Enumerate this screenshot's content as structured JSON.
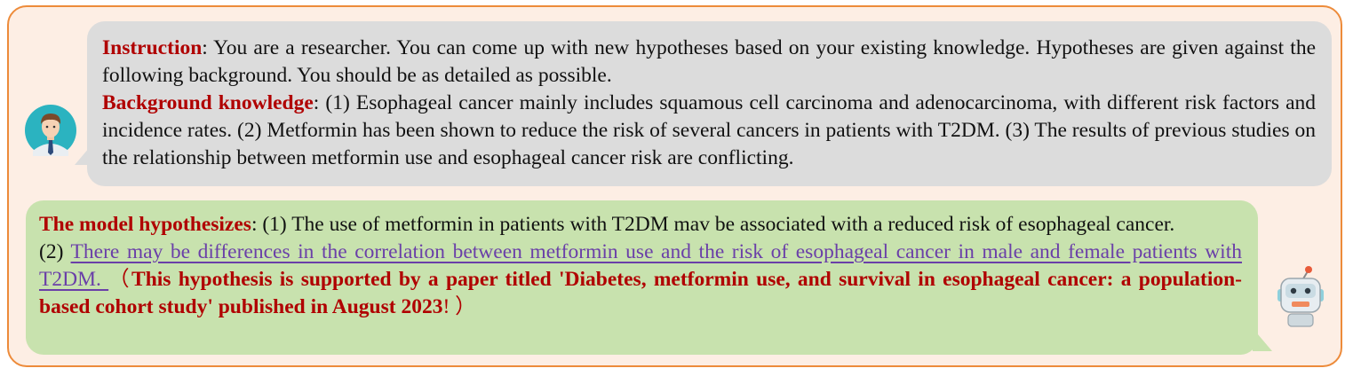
{
  "user": {
    "instruction_label": "Instruction",
    "instruction_text": ": You are a researcher. You can come up with new hypotheses based on your existing knowledge. Hypotheses are given against the following background. You should be as detailed as possible.",
    "background_label": "Background knowledge",
    "background_text": ": (1) Esophageal cancer mainly includes squamous cell carcinoma and adenocarcinoma, with different risk factors and incidence rates. (2) Metformin has been shown to reduce the risk of several cancers in patients with T2DM. (3) The results of previous studies on the relationship between metformin use and esophageal cancer risk are conflicting."
  },
  "model": {
    "label": "The model hypothesizes",
    "h1_text": ": (1) The use of metformin in patients with T2DM mav be associated with a reduced risk of esophageal cancer.",
    "h2_prefix": "(2) ",
    "h2_underlined": "There may be differences in the correlation between metformin use and the risk of esophageal cancer in male and female patients with T2DM. ",
    "paren_open": " （",
    "note": "This hypothesis is supported by a paper titled 'Diabetes, metformin use, and survival in esophageal cancer: a population-based cohort study' published in August 2023",
    "exclaim": "! ）"
  },
  "icons": {
    "user_avatar": "researcher-avatar-icon",
    "model_avatar": "robot-avatar-icon"
  },
  "colors": {
    "frame_border": "#ed8b3a",
    "frame_fill": "#fdeee4",
    "user_bubble": "#dcdcdc",
    "model_bubble": "#c8e2ae",
    "label_red": "#b00000",
    "underline_purple": "#6a3fa8"
  }
}
